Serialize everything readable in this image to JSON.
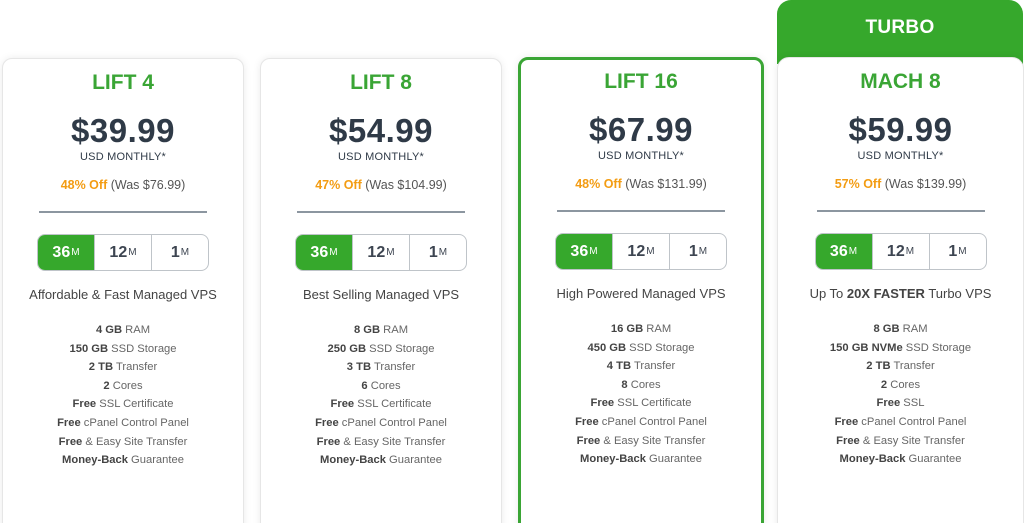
{
  "turbo_banner": "TURBO",
  "term_unit": "M",
  "plans": [
    {
      "name": "LIFT 4",
      "price": "$39.99",
      "period": "USD MONTHLY*",
      "discount": "48% Off",
      "was": "(Was $76.99)",
      "terms": [
        "36",
        "12",
        "1"
      ],
      "selected_term": "36",
      "tagline_pre": "Affordable & Fast Managed VPS",
      "tagline_bold": "",
      "tagline_post": "",
      "features": [
        {
          "bold": "4 GB",
          "text": " RAM"
        },
        {
          "bold": "150 GB",
          "text": " SSD Storage"
        },
        {
          "bold": "2 TB",
          "text": " Transfer"
        },
        {
          "bold": "2",
          "text": " Cores"
        },
        {
          "bold": "Free",
          "text": " SSL Certificate"
        },
        {
          "bold": "Free",
          "text": " cPanel Control Panel"
        },
        {
          "bold": "Free",
          "text": " & Easy Site Transfer"
        },
        {
          "bold": "Money-Back",
          "text": " Guarantee"
        }
      ]
    },
    {
      "name": "LIFT 8",
      "price": "$54.99",
      "period": "USD MONTHLY*",
      "discount": "47% Off",
      "was": "(Was $104.99)",
      "terms": [
        "36",
        "12",
        "1"
      ],
      "selected_term": "36",
      "tagline_pre": "Best Selling Managed VPS",
      "tagline_bold": "",
      "tagline_post": "",
      "features": [
        {
          "bold": "8 GB",
          "text": " RAM"
        },
        {
          "bold": "250 GB",
          "text": " SSD Storage"
        },
        {
          "bold": "3 TB",
          "text": " Transfer"
        },
        {
          "bold": "6",
          "text": " Cores"
        },
        {
          "bold": "Free",
          "text": " SSL Certificate"
        },
        {
          "bold": "Free",
          "text": " cPanel Control Panel"
        },
        {
          "bold": "Free",
          "text": " & Easy Site Transfer"
        },
        {
          "bold": "Money-Back",
          "text": " Guarantee"
        }
      ]
    },
    {
      "name": "LIFT 16",
      "price": "$67.99",
      "period": "USD MONTHLY*",
      "discount": "48% Off",
      "was": "(Was $131.99)",
      "terms": [
        "36",
        "12",
        "1"
      ],
      "selected_term": "36",
      "tagline_pre": "High Powered Managed VPS",
      "tagline_bold": "",
      "tagline_post": "",
      "features": [
        {
          "bold": "16 GB",
          "text": " RAM"
        },
        {
          "bold": "450 GB",
          "text": " SSD Storage"
        },
        {
          "bold": "4 TB",
          "text": " Transfer"
        },
        {
          "bold": "8",
          "text": " Cores"
        },
        {
          "bold": "Free",
          "text": " SSL Certificate"
        },
        {
          "bold": "Free",
          "text": " cPanel Control Panel"
        },
        {
          "bold": "Free",
          "text": " & Easy Site Transfer"
        },
        {
          "bold": "Money-Back",
          "text": " Guarantee"
        }
      ]
    },
    {
      "name": "MACH 8",
      "price": "$59.99",
      "period": "USD MONTHLY*",
      "discount": "57% Off",
      "was": "(Was $139.99)",
      "terms": [
        "36",
        "12",
        "1"
      ],
      "selected_term": "36",
      "tagline_pre": "Up To ",
      "tagline_bold": "20X FASTER",
      "tagline_post": " Turbo VPS",
      "features": [
        {
          "bold": "8 GB",
          "text": " RAM"
        },
        {
          "bold": "150 GB NVMe",
          "text": " SSD Storage"
        },
        {
          "bold": "2 TB",
          "text": " Transfer"
        },
        {
          "bold": "2",
          "text": " Cores"
        },
        {
          "bold": "Free",
          "text": " SSL"
        },
        {
          "bold": "Free",
          "text": " cPanel Control Panel"
        },
        {
          "bold": "Free",
          "text": " & Easy Site Transfer"
        },
        {
          "bold": "Money-Back",
          "text": " Guarantee"
        }
      ]
    }
  ],
  "colors": {
    "brand_green": "#36a82c",
    "discount_orange": "#f39c12",
    "price_dark": "#2f3a47"
  }
}
